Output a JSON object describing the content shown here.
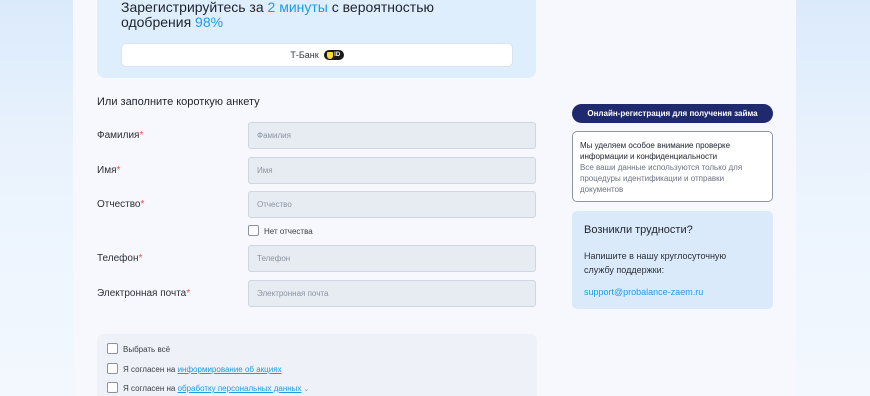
{
  "banner": {
    "title_part1": "Зарегистрируйтесь за ",
    "title_highlight1": "2 минуты",
    "title_part2": "  с вероятностью",
    "title_part3": "одобрения ",
    "title_highlight2": "98%",
    "tbank_label": "Т-Банк",
    "tid_badge": "ID"
  },
  "form": {
    "heading": "Или заполните короткую анкету",
    "fields": [
      {
        "label": "Фамилия",
        "placeholder": "Фамилия"
      },
      {
        "label": "Имя",
        "placeholder": "Имя"
      },
      {
        "label": "Отчество",
        "placeholder": "Отчество"
      },
      {
        "label": "Телефон",
        "placeholder": "Телефон"
      },
      {
        "label": "Электронная почта",
        "placeholder": "Электронная почта"
      }
    ],
    "required_mark": "*",
    "no_patronymic_label": "Нет отчества"
  },
  "consents": {
    "select_all": "Выбрать всё",
    "item1_prefix": "Я согласен на ",
    "item1_link": "информирование об акциях",
    "item2_prefix": "Я согласен на ",
    "item2_link": "обработку персональных данных",
    "chevron": "⌄"
  },
  "sidebar": {
    "online_button": "Онлайн-регистрация для получения займа",
    "privacy_title": "Мы уделяем особое внимание проверке информации и конфиденциальности",
    "privacy_text": "Все ваши данные используются только для процедуры идентификации и отправки документов",
    "help_title": "Возникли трудности?",
    "help_text": "Напишите в нашу круглосуточную службу поддержки:",
    "help_email": "support@probalance-zaem.ru"
  },
  "colors": {
    "accent": "#1e9be6",
    "button_dark": "#1f2a6e",
    "required": "#e2524d"
  }
}
